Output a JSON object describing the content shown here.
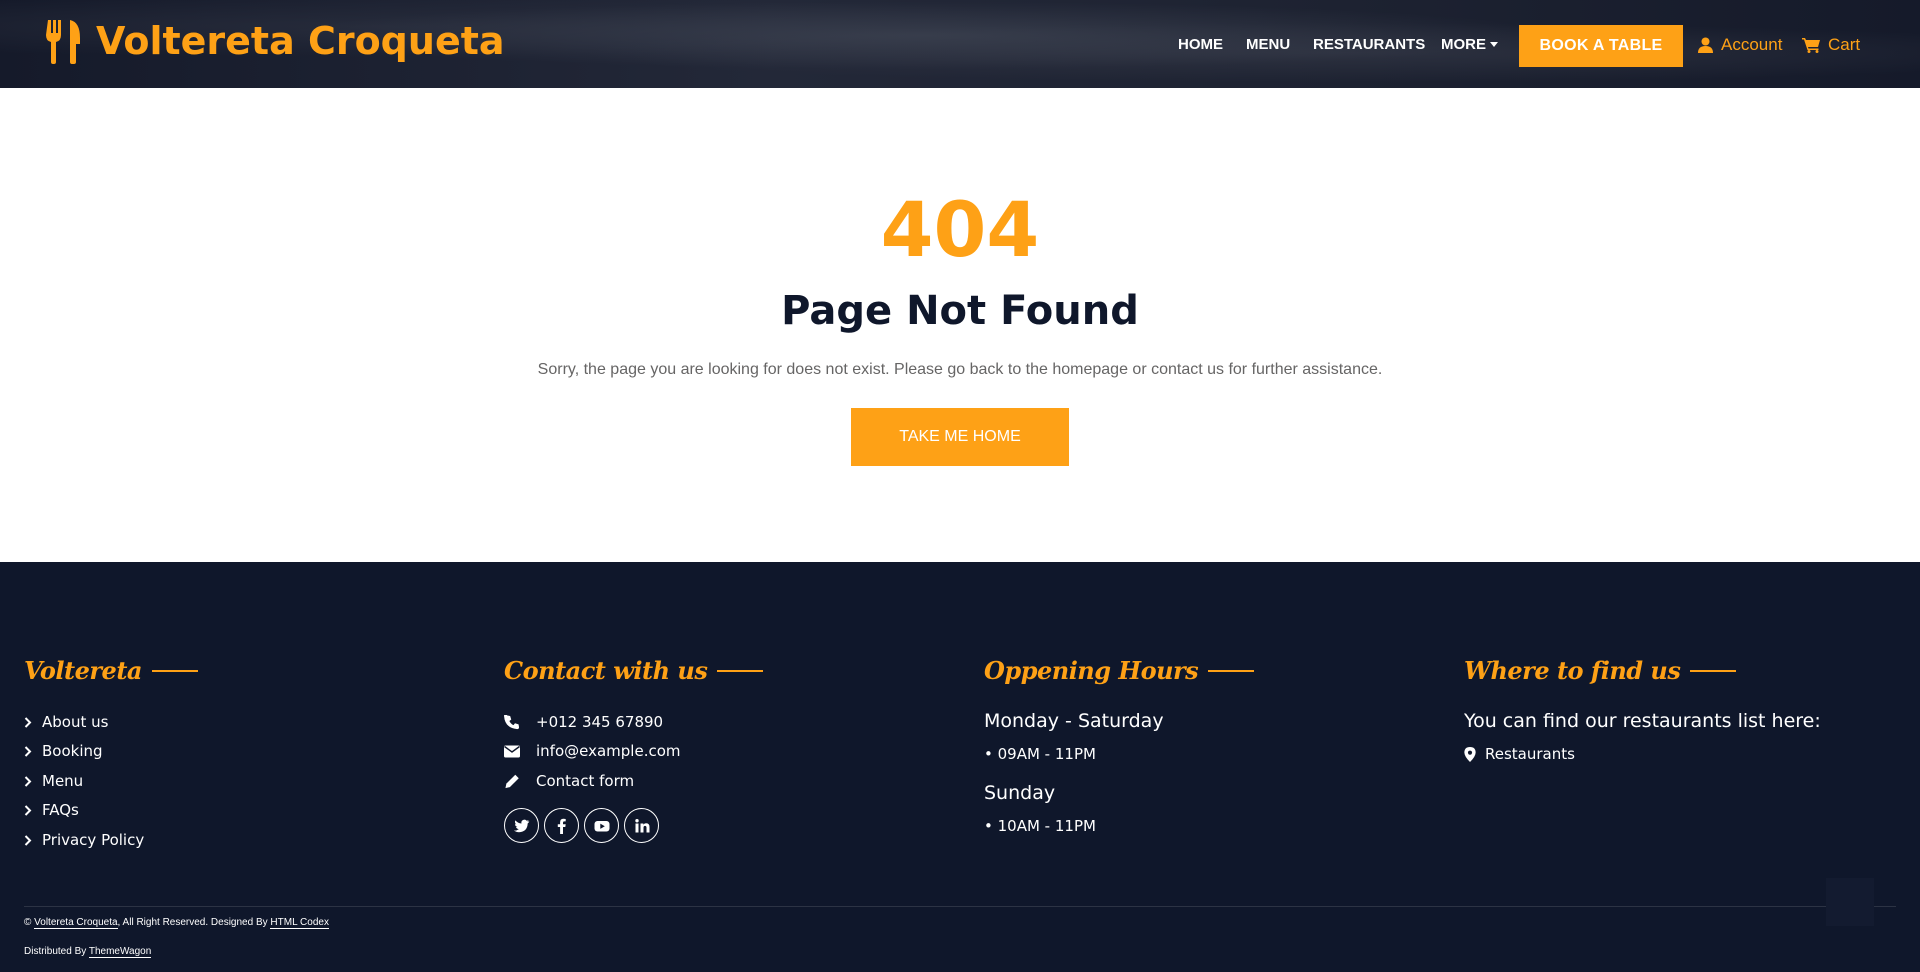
{
  "navbar": {
    "brand": "Voltereta Croqueta",
    "links": [
      "HOME",
      "MENU",
      "RESTAURANTS",
      "MORE"
    ],
    "book_label": "BOOK A TABLE",
    "account_label": "Account",
    "cart_label": "Cart"
  },
  "error": {
    "code": "404",
    "title": "Page Not Found",
    "message": "Sorry, the page you are looking for does not exist. Please go back to the homepage or contact us for further assistance.",
    "button_label": "TAKE ME HOME"
  },
  "footer": {
    "col1": {
      "title": "Voltereta",
      "links": [
        "About us",
        "Booking",
        "Menu",
        "FAQs",
        "Privacy Policy"
      ]
    },
    "col2": {
      "title": "Contact with us",
      "phone": "+012 345 67890",
      "email": "info@example.com",
      "form": "Contact form",
      "social": [
        "twitter-icon",
        "facebook-icon",
        "youtube-icon",
        "linkedin-icon"
      ]
    },
    "col3": {
      "title": "Oppening Hours",
      "day1": "Monday - Saturday",
      "time1": "• 09AM - 11PM",
      "day2": "Sunday",
      "time2": "• 10AM - 11PM"
    },
    "col4": {
      "title": "Where to find us",
      "text": "You can find our restaurants list here:",
      "link": "Restaurants"
    },
    "copyright": {
      "prefix": "©",
      "brand": "Voltereta Croqueta",
      "middle": ", All Right Reserved. Designed By",
      "designer": "HTML Codex",
      "distributed_prefix": "Distributed By",
      "distributor": "ThemeWagon"
    }
  },
  "colors": {
    "accent": "#FEA116",
    "dark": "#0F172B"
  }
}
